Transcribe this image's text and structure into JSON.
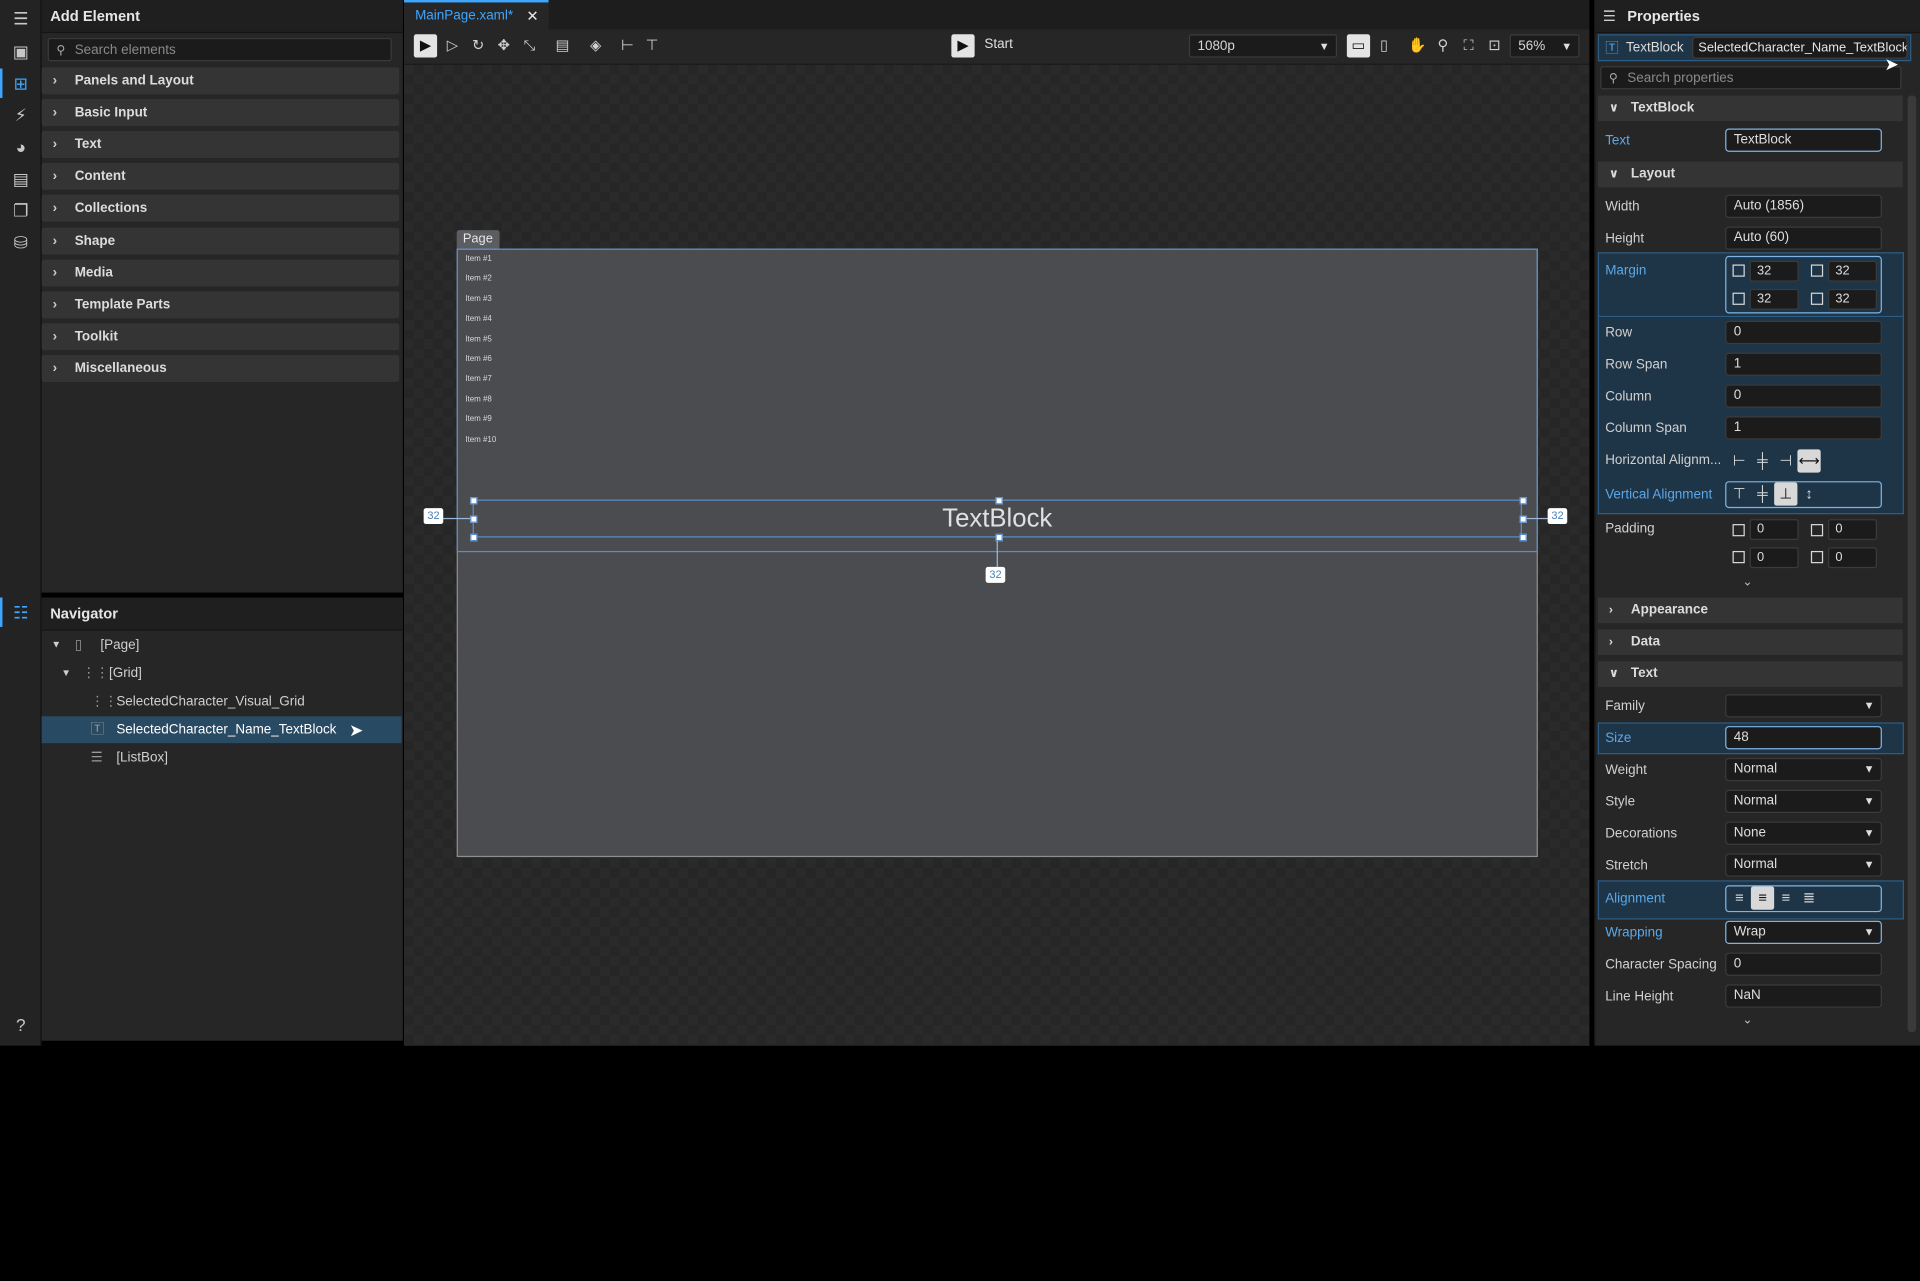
{
  "add_element": {
    "title": "Add Element",
    "search_placeholder": "Search elements",
    "categories": [
      "Panels and Layout",
      "Basic Input",
      "Text",
      "Content",
      "Collections",
      "Shape",
      "Media",
      "Template Parts",
      "Toolkit",
      "Miscellaneous"
    ]
  },
  "navigator": {
    "title": "Navigator",
    "items": [
      {
        "label": "[Page]"
      },
      {
        "label": "[Grid]"
      },
      {
        "label": "SelectedCharacter_Visual_Grid"
      },
      {
        "label": "SelectedCharacter_Name_TextBlock"
      },
      {
        "label": "[ListBox]"
      }
    ]
  },
  "document": {
    "tab_label": "MainPage.xaml*",
    "start_label": "Start",
    "resolution": "1080p",
    "zoom": "56%",
    "page_tag": "Page",
    "list_items": [
      "Item #1",
      "Item #2",
      "Item #3",
      "Item #4",
      "Item #5",
      "Item #6",
      "Item #7",
      "Item #8",
      "Item #9",
      "Item #10"
    ],
    "textblock_text": "TextBlock",
    "margin_badges": {
      "left": "32",
      "right": "32",
      "bottom": "32"
    }
  },
  "properties": {
    "title": "Properties",
    "element_type": "TextBlock",
    "element_name": "SelectedCharacter_Name_TextBlock",
    "search_placeholder": "Search properties",
    "sections": {
      "textblock": "TextBlock",
      "layout": "Layout",
      "appearance": "Appearance",
      "data": "Data",
      "text": "Text"
    },
    "labels": {
      "text": "Text",
      "width": "Width",
      "height": "Height",
      "margin": "Margin",
      "row": "Row",
      "row_span": "Row Span",
      "column": "Column",
      "column_span": "Column Span",
      "h_align": "Horizontal Alignm...",
      "v_align": "Vertical Alignment",
      "padding": "Padding",
      "family": "Family",
      "size": "Size",
      "weight": "Weight",
      "style": "Style",
      "decorations": "Decorations",
      "stretch": "Stretch",
      "alignment": "Alignment",
      "wrapping": "Wrapping",
      "char_spacing": "Character Spacing",
      "line_height": "Line Height"
    },
    "values": {
      "text": "TextBlock",
      "width": "Auto (1856)",
      "height": "Auto (60)",
      "margin": [
        "32",
        "32",
        "32",
        "32"
      ],
      "row": "0",
      "row_span": "1",
      "column": "0",
      "column_span": "1",
      "padding": [
        "0",
        "0",
        "0",
        "0"
      ],
      "family": "",
      "size": "48",
      "weight": "Normal",
      "style": "Normal",
      "decorations": "None",
      "stretch": "Normal",
      "wrapping": "Wrap",
      "char_spacing": "0",
      "line_height": "NaN"
    }
  },
  "colors": {
    "accent": "#3ea6ff",
    "selection": "#284a63",
    "canvas_page": "#4a4c50"
  }
}
